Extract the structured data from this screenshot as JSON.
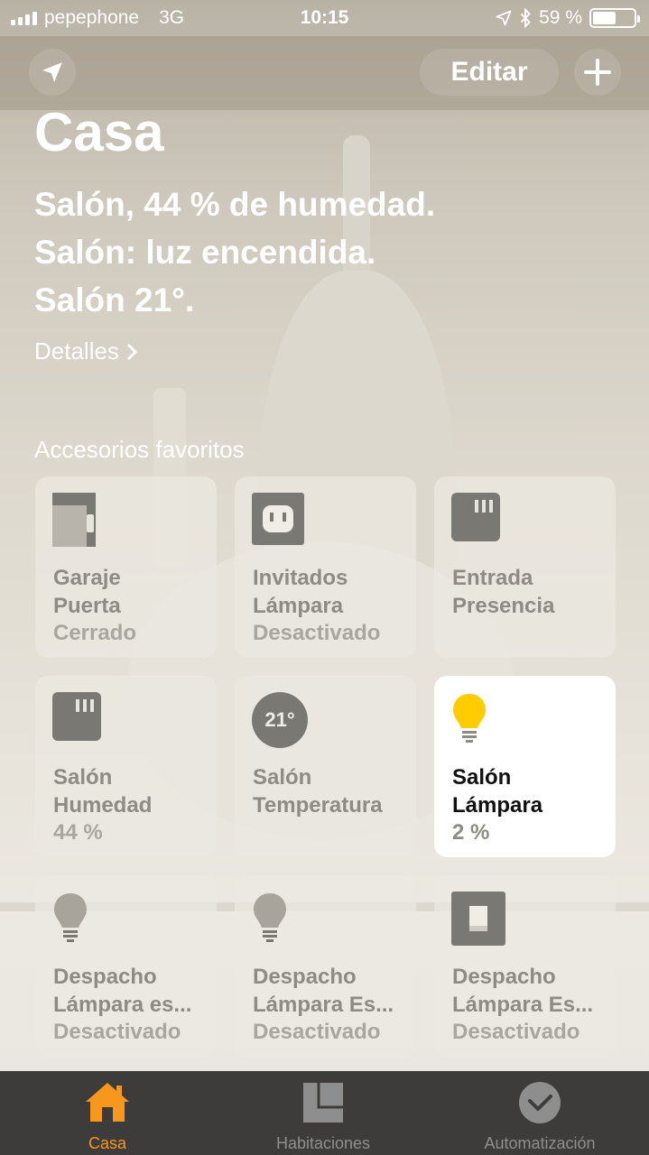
{
  "status_bar": {
    "carrier": "pepephone",
    "network": "3G",
    "time": "10:15",
    "battery": "59 %",
    "battery_level": 0.59
  },
  "nav": {
    "location_icon": "location-arrow-icon",
    "edit_label": "Editar",
    "add_label": "+"
  },
  "home": {
    "title": "Casa",
    "summary": [
      "Salón, 44 % de humedad.",
      "Salón: luz encendida.",
      "Salón 21°."
    ],
    "details_label": "Detalles",
    "favorites_label": "Accesorios favoritos"
  },
  "accessories": [
    {
      "icon": "garage-door-icon",
      "name1": "Garaje",
      "name2": "Puerta",
      "state": "Cerrado",
      "active": false
    },
    {
      "icon": "outlet-icon",
      "name1": "Invitados",
      "name2": "Lámpara",
      "state": "Desactivado",
      "active": false
    },
    {
      "icon": "sensor-icon",
      "name1": "Entrada",
      "name2": "Presencia",
      "state": "",
      "active": false
    },
    {
      "icon": "sensor-icon",
      "name1": "Salón",
      "name2": "Humedad",
      "state": "44 %",
      "active": false
    },
    {
      "icon": "thermostat-icon",
      "name1": "Salón",
      "name2": "Temperatura",
      "state": "",
      "reading": "21°",
      "active": false
    },
    {
      "icon": "lightbulb-icon",
      "name1": "Salón",
      "name2": "Lámpara",
      "state": "2 %",
      "active": true
    },
    {
      "icon": "lightbulb-icon",
      "name1": "Despacho",
      "name2": "Lámpara es...",
      "state": "Desactivado",
      "active": false
    },
    {
      "icon": "lightbulb-icon",
      "name1": "Despacho",
      "name2": "Lámpara Es...",
      "state": "Desactivado",
      "active": false
    },
    {
      "icon": "switch-icon",
      "name1": "Despacho",
      "name2": "Lámpara Es...",
      "state": "Desactivado",
      "active": false
    }
  ],
  "tabs": [
    {
      "label": "Casa",
      "icon": "home-icon",
      "active": true
    },
    {
      "label": "Habitaciones",
      "icon": "rooms-icon",
      "active": false
    },
    {
      "label": "Automatización",
      "icon": "clock-icon",
      "active": false
    }
  ],
  "colors": {
    "accent": "#f7981d",
    "bulb_on": "#ffcc00",
    "tab_inactive": "#8e8e8e",
    "tab_bar_bg": "#3d3c3b"
  }
}
